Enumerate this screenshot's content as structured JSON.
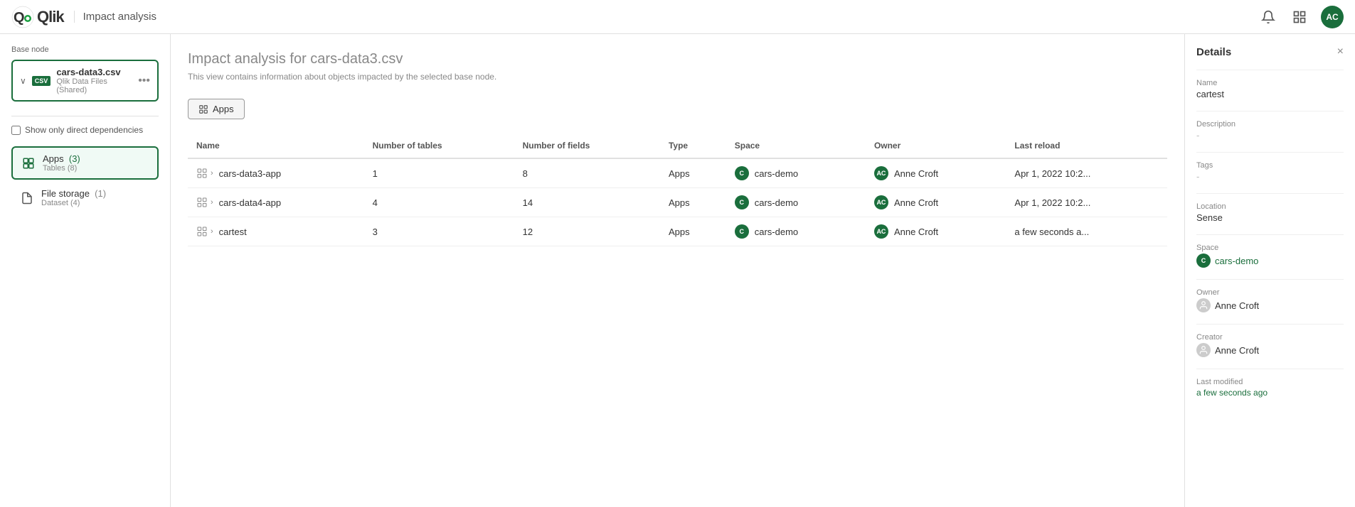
{
  "header": {
    "title": "Impact analysis",
    "avatar_initials": "AC"
  },
  "left_panel": {
    "base_node_label": "Base node",
    "base_node_name": "cars-data3.csv",
    "base_node_sub": "Qlik Data Files (Shared)",
    "checkbox_label": "Show only direct dependencies",
    "tree_items": [
      {
        "name": "Apps",
        "count": "(3)",
        "sub": "Tables (8)",
        "selected": true
      },
      {
        "name": "File storage",
        "count": "(1)",
        "sub": "Dataset (4)",
        "selected": false
      }
    ]
  },
  "content": {
    "title": "Impact analysis for cars-data3.csv",
    "subtitle": "This view contains information about objects impacted by the selected base node.",
    "apps_button_label": "Apps",
    "table": {
      "columns": [
        "Name",
        "Number of tables",
        "Number of fields",
        "Type",
        "Space",
        "Owner",
        "Last reload"
      ],
      "rows": [
        {
          "name": "cars-data3-app",
          "num_tables": "1",
          "num_fields": "8",
          "type": "Apps",
          "space": "cars-demo",
          "owner": "Anne Croft",
          "last_reload": "Apr 1, 2022 10:2..."
        },
        {
          "name": "cars-data4-app",
          "num_tables": "4",
          "num_fields": "14",
          "type": "Apps",
          "space": "cars-demo",
          "owner": "Anne Croft",
          "last_reload": "Apr 1, 2022 10:2..."
        },
        {
          "name": "cartest",
          "num_tables": "3",
          "num_fields": "12",
          "type": "Apps",
          "space": "cars-demo",
          "owner": "Anne Croft",
          "last_reload": "a few seconds a..."
        }
      ]
    }
  },
  "right_panel": {
    "title": "Details",
    "name_label": "Name",
    "name_value": "cartest",
    "description_label": "Description",
    "description_value": "-",
    "tags_label": "Tags",
    "tags_value": "-",
    "location_label": "Location",
    "location_value": "Sense",
    "space_label": "Space",
    "space_value": "cars-demo",
    "space_icon": "C",
    "owner_label": "Owner",
    "owner_value": "Anne Croft",
    "creator_label": "Creator",
    "creator_value": "Anne Croft",
    "last_modified_label": "Last modified",
    "last_modified_value": "a few seconds ago"
  },
  "icons": {
    "bell": "🔔",
    "grid": "⋮⋮⋮",
    "chevron_down": "∨",
    "chevron_right": "›",
    "more": "•••",
    "close": "×",
    "apps_icon": "⊞",
    "file_icon": "📄",
    "chart_icon": "📊"
  }
}
